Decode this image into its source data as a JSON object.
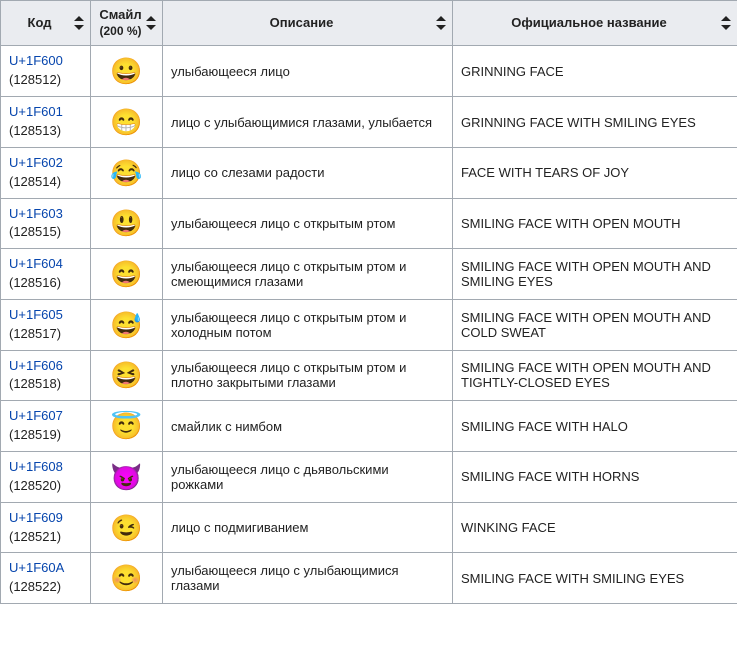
{
  "headers": {
    "code": "Код",
    "emoji": "Смайл",
    "emoji_sub": "(200 %)",
    "desc": "Описание",
    "name": "Официальное название"
  },
  "rows": [
    {
      "hex": "U+1F600",
      "dec": "(128512)",
      "emoji": "😀",
      "desc": "улыбающееся лицо",
      "name": "GRINNING FACE"
    },
    {
      "hex": "U+1F601",
      "dec": "(128513)",
      "emoji": "😁",
      "desc": "лицо с улыбающимися глазами, улыбается",
      "name": "GRINNING FACE WITH SMILING EYES"
    },
    {
      "hex": "U+1F602",
      "dec": "(128514)",
      "emoji": "😂",
      "desc": "лицо со слезами радости",
      "name": "FACE WITH TEARS OF JOY"
    },
    {
      "hex": "U+1F603",
      "dec": "(128515)",
      "emoji": "😃",
      "desc": "улыбающееся лицо с открытым ртом",
      "name": "SMILING FACE WITH OPEN MOUTH"
    },
    {
      "hex": "U+1F604",
      "dec": "(128516)",
      "emoji": "😄",
      "desc": "улыбающееся лицо с открытым ртом и смеющимися глазами",
      "name": "SMILING FACE WITH OPEN MOUTH AND SMILING EYES"
    },
    {
      "hex": "U+1F605",
      "dec": "(128517)",
      "emoji": "😅",
      "desc": "улыбающееся лицо с открытым ртом и холодным потом",
      "name": "SMILING FACE WITH OPEN MOUTH AND COLD SWEAT"
    },
    {
      "hex": "U+1F606",
      "dec": "(128518)",
      "emoji": "😆",
      "desc": "улыбающееся лицо с открытым ртом и плотно закрытыми глазами",
      "name": "SMILING FACE WITH OPEN MOUTH AND TIGHTLY-CLOSED EYES"
    },
    {
      "hex": "U+1F607",
      "dec": "(128519)",
      "emoji": "😇",
      "desc": "смайлик с нимбом",
      "name": "SMILING FACE WITH HALO"
    },
    {
      "hex": "U+1F608",
      "dec": "(128520)",
      "emoji": "😈",
      "desc": "улыбающееся лицо с дьявольскими рожками",
      "name": "SMILING FACE WITH HORNS"
    },
    {
      "hex": "U+1F609",
      "dec": "(128521)",
      "emoji": "😉",
      "desc": "лицо с подмигиванием",
      "name": "WINKING FACE"
    },
    {
      "hex": "U+1F60A",
      "dec": "(128522)",
      "emoji": "😊",
      "desc": "улыбающееся лицо с улыбающимися глазами",
      "name": "SMILING FACE WITH SMILING EYES"
    }
  ]
}
